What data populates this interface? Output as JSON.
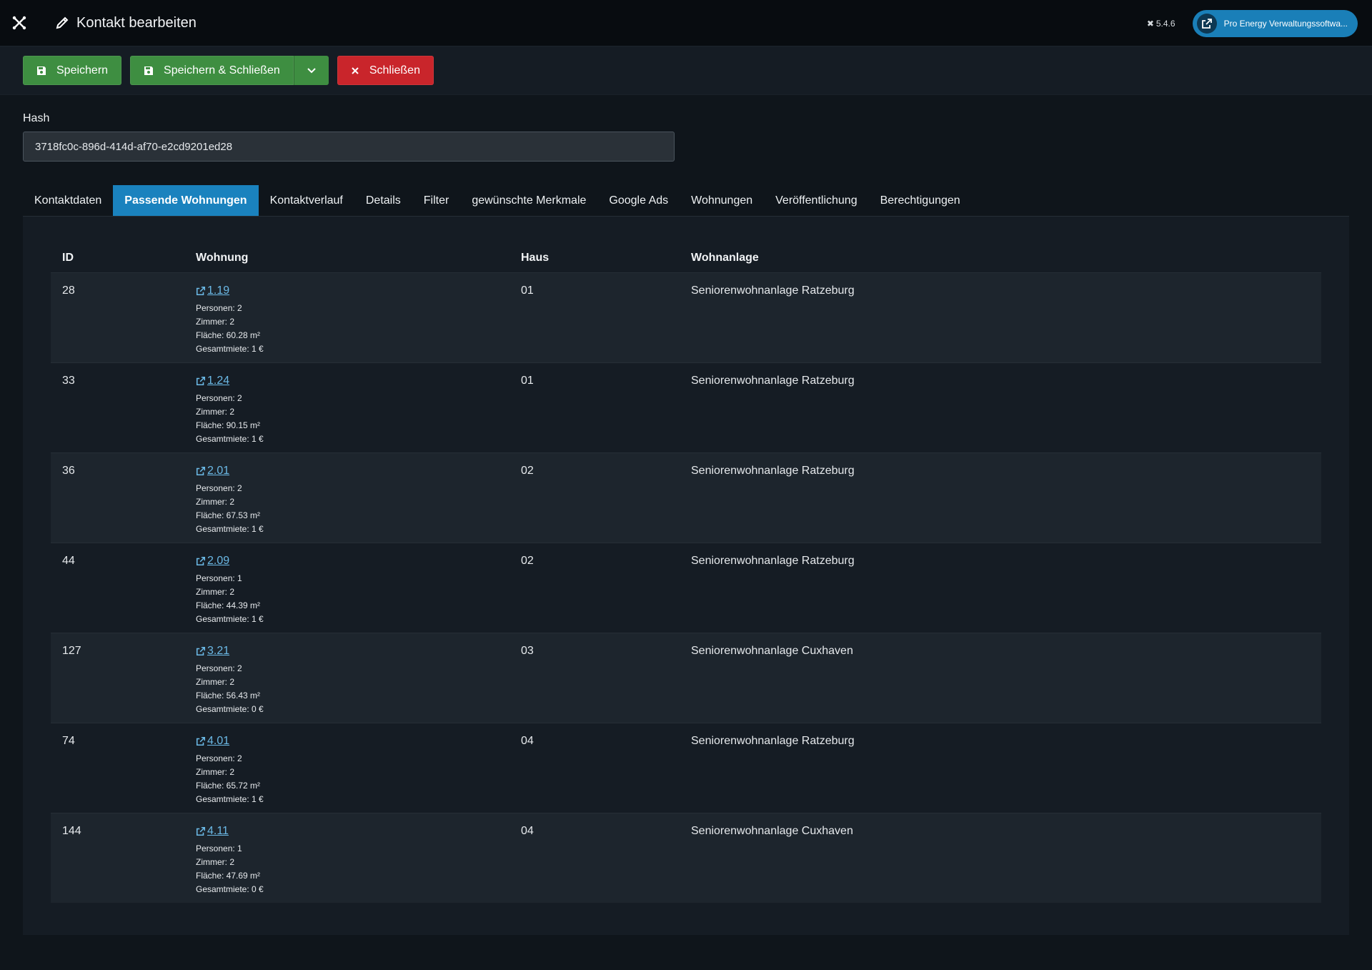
{
  "header": {
    "title": "Kontakt bearbeiten",
    "version": "5.4.6",
    "site_button": "Pro Energy Verwaltungssoftwa..."
  },
  "toolbar": {
    "save": "Speichern",
    "save_close": "Speichern & Schließen",
    "close": "Schließen"
  },
  "form": {
    "hash_label": "Hash",
    "hash_value": "3718fc0c-896d-414d-af70-e2cd9201ed28"
  },
  "tabs": [
    "Kontaktdaten",
    "Passende Wohnungen",
    "Kontaktverlauf",
    "Details",
    "Filter",
    "gewünschte Merkmale",
    "Google Ads",
    "Wohnungen",
    "Veröffentlichung",
    "Berechtigungen"
  ],
  "active_tab": "Passende Wohnungen",
  "table": {
    "headers": {
      "id": "ID",
      "wohnung": "Wohnung",
      "haus": "Haus",
      "anlage": "Wohnanlage"
    },
    "rows": [
      {
        "id": "28",
        "wohnung": "1.19",
        "personen": "Personen: 2",
        "zimmer": "Zimmer: 2",
        "flaeche": "Fläche: 60.28 m²",
        "miete": "Gesamtmiete: 1 €",
        "haus": "01",
        "anlage": "Seniorenwohnanlage Ratzeburg"
      },
      {
        "id": "33",
        "wohnung": "1.24",
        "personen": "Personen: 2",
        "zimmer": "Zimmer: 2",
        "flaeche": "Fläche: 90.15 m²",
        "miete": "Gesamtmiete: 1 €",
        "haus": "01",
        "anlage": "Seniorenwohnanlage Ratzeburg"
      },
      {
        "id": "36",
        "wohnung": "2.01",
        "personen": "Personen: 2",
        "zimmer": "Zimmer: 2",
        "flaeche": "Fläche: 67.53 m²",
        "miete": "Gesamtmiete: 1 €",
        "haus": "02",
        "anlage": "Seniorenwohnanlage Ratzeburg"
      },
      {
        "id": "44",
        "wohnung": "2.09",
        "personen": "Personen: 1",
        "zimmer": "Zimmer: 2",
        "flaeche": "Fläche: 44.39 m²",
        "miete": "Gesamtmiete: 1 €",
        "haus": "02",
        "anlage": "Seniorenwohnanlage Ratzeburg"
      },
      {
        "id": "127",
        "wohnung": "3.21",
        "personen": "Personen: 2",
        "zimmer": "Zimmer: 2",
        "flaeche": "Fläche: 56.43 m²",
        "miete": "Gesamtmiete: 0 €",
        "haus": "03",
        "anlage": "Seniorenwohnanlage Cuxhaven"
      },
      {
        "id": "74",
        "wohnung": "4.01",
        "personen": "Personen: 2",
        "zimmer": "Zimmer: 2",
        "flaeche": "Fläche: 65.72 m²",
        "miete": "Gesamtmiete: 1 €",
        "haus": "04",
        "anlage": "Seniorenwohnanlage Ratzeburg"
      },
      {
        "id": "144",
        "wohnung": "4.11",
        "personen": "Personen: 1",
        "zimmer": "Zimmer: 2",
        "flaeche": "Fläche: 47.69 m²",
        "miete": "Gesamtmiete: 0 €",
        "haus": "04",
        "anlage": "Seniorenwohnanlage Cuxhaven"
      }
    ]
  },
  "colors": {
    "accent": "#1a82be",
    "save_green": "#3e8e41",
    "close_red": "#c9252b",
    "link": "#6bb9e6"
  },
  "icons": {
    "logo": "joomla-logo-icon",
    "title": "pencil-icon",
    "version": "joomla-small-icon",
    "site": "external-link-icon",
    "save": "floppy-disk-icon",
    "close": "x-icon",
    "dropdown": "chevron-down-icon",
    "row_link": "external-link-icon"
  }
}
